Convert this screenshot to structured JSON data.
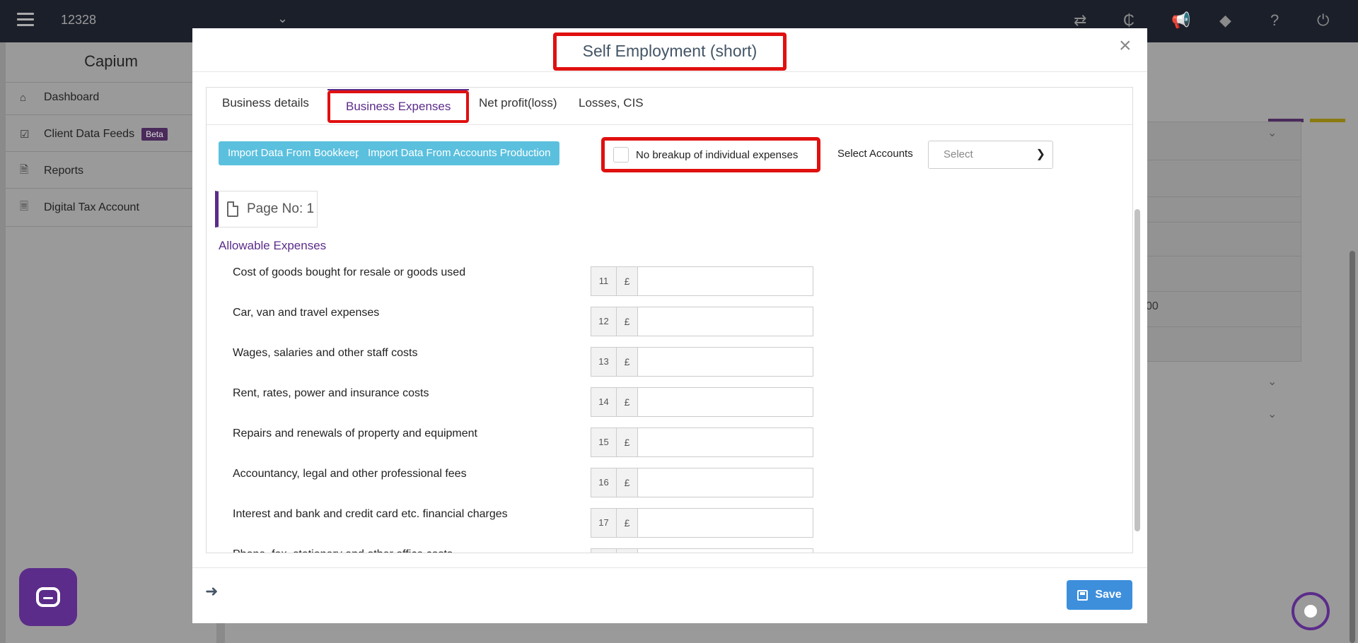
{
  "topbar": {
    "client_id": "12328",
    "icons": [
      "transfer-icon",
      "capium-icon",
      "megaphone-icon",
      "ticket-icon",
      "help-icon",
      "power-icon"
    ]
  },
  "sidebar": {
    "brand": "Capium",
    "items": [
      {
        "label": "Dashboard",
        "icon": "home-icon"
      },
      {
        "label": "Client Data Feeds",
        "icon": "checkbox-icon",
        "badge": "Beta"
      },
      {
        "label": "Reports",
        "icon": "document-icon"
      },
      {
        "label": "Digital Tax Account",
        "icon": "file-text-icon"
      }
    ]
  },
  "background": {
    "partial_value": "00"
  },
  "modal": {
    "title": "Self Employment (short)",
    "tabs": [
      {
        "label": "Business details",
        "active": false
      },
      {
        "label": "Business Expenses",
        "active": true
      },
      {
        "label": "Net profit(loss)",
        "active": false
      },
      {
        "label": "Losses, CIS",
        "active": false
      }
    ],
    "toolbar": {
      "import_bookkeeping": "Import Data From Bookkeeping",
      "import_accounts": "Import Data From Accounts Production",
      "no_breakup_label": "No breakup of individual expenses",
      "no_breakup_checked": false,
      "select_accounts_label": "Select Accounts",
      "select_placeholder": "Select"
    },
    "page_no": "Page No: 1",
    "section_title": "Allowable Expenses",
    "expenses": [
      {
        "box": "11",
        "currency": "£",
        "label": "Cost of goods bought for resale or goods used",
        "value": ""
      },
      {
        "box": "12",
        "currency": "£",
        "label": "Car, van and travel expenses",
        "value": ""
      },
      {
        "box": "13",
        "currency": "£",
        "label": "Wages, salaries and other staff costs",
        "value": ""
      },
      {
        "box": "14",
        "currency": "£",
        "label": "Rent, rates, power and insurance costs",
        "value": ""
      },
      {
        "box": "15",
        "currency": "£",
        "label": "Repairs and renewals of property and equipment",
        "value": ""
      },
      {
        "box": "16",
        "currency": "£",
        "label": "Accountancy, legal and other professional fees",
        "value": ""
      },
      {
        "box": "17",
        "currency": "£",
        "label": "Interest and bank and credit card etc. financial charges",
        "value": ""
      },
      {
        "box": "",
        "currency": "",
        "label": "Phone, fax, stationery and other office costs",
        "value": ""
      }
    ],
    "save_label": "Save"
  },
  "colors": {
    "accent_purple": "#5b2c8a",
    "import_button": "#5bc0de",
    "save_button": "#3d8fdc",
    "highlight_red": "#e01010"
  }
}
